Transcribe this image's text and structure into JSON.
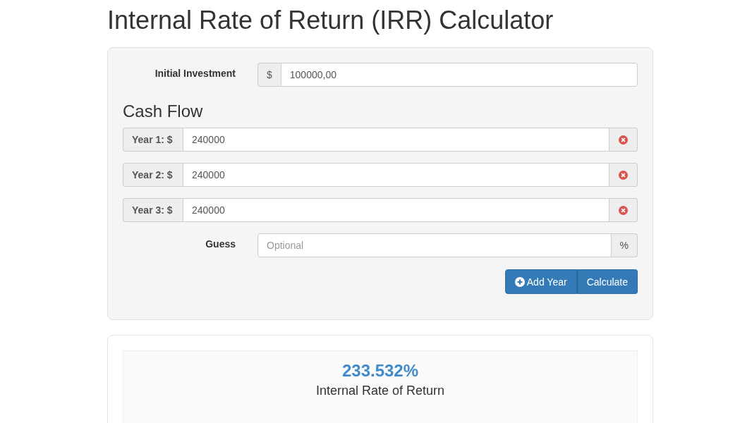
{
  "title": "Internal Rate of Return (IRR) Calculator",
  "initial_investment": {
    "label": "Initial Investment",
    "addon": "$",
    "value": "100000,00"
  },
  "cash_flow": {
    "heading": "Cash Flow",
    "years": [
      {
        "label": "Year 1: $",
        "value": "240000"
      },
      {
        "label": "Year 2: $",
        "value": "240000"
      },
      {
        "label": "Year 3: $",
        "value": "240000"
      }
    ]
  },
  "guess": {
    "label": "Guess",
    "placeholder": "Optional",
    "addon": "%"
  },
  "buttons": [
    {
      "kind": "add",
      "label": "Add Year"
    },
    {
      "kind": "calculate",
      "label": "Calculate"
    }
  ],
  "result": {
    "value": "233.532%",
    "caption": "Internal Rate of Return"
  }
}
